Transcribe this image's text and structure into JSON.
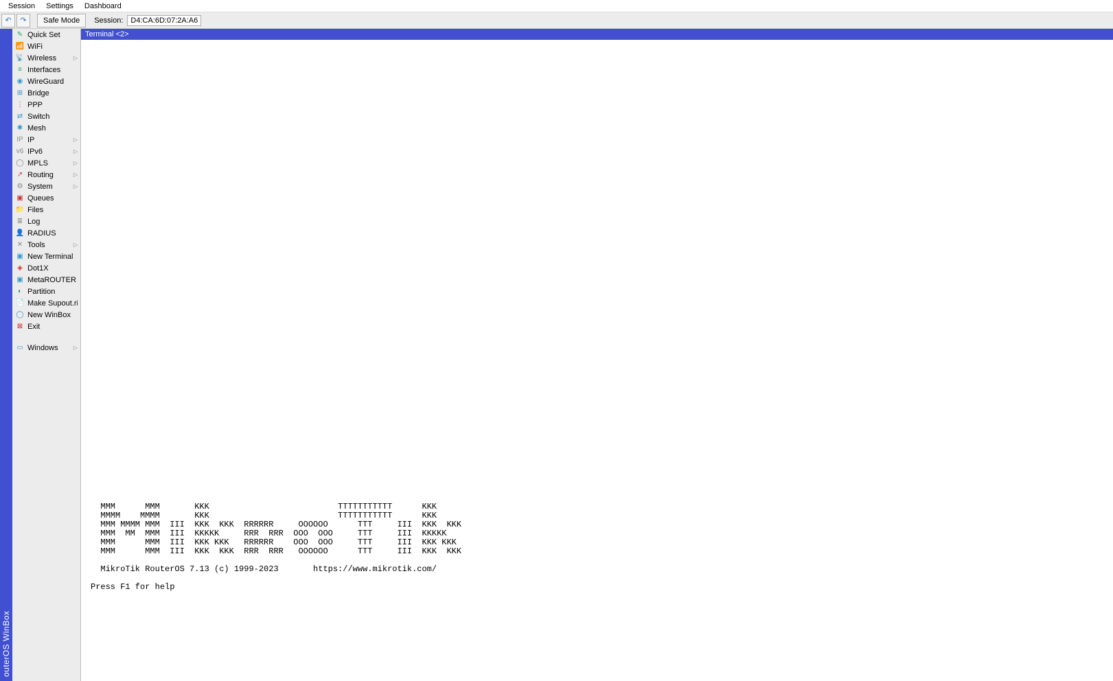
{
  "menubar": [
    "Session",
    "Settings",
    "Dashboard"
  ],
  "toolbar": {
    "undo_glyph": "↶",
    "redo_glyph": "↷",
    "safe_mode": "Safe Mode",
    "session_label": "Session:",
    "session_value": "D4:CA:6D:07:2A:A6"
  },
  "vbar_text": "outerOS WinBox",
  "sidebar": [
    {
      "icon": "✎",
      "color": "#2a6",
      "label": "Quick Set",
      "arrow": false
    },
    {
      "icon": "📶",
      "color": "#39c",
      "label": "WiFi",
      "arrow": false
    },
    {
      "icon": "📡",
      "color": "#39c",
      "label": "Wireless",
      "arrow": true
    },
    {
      "icon": "≡",
      "color": "#2a6",
      "label": "Interfaces",
      "arrow": false
    },
    {
      "icon": "◉",
      "color": "#39c",
      "label": "WireGuard",
      "arrow": false
    },
    {
      "icon": "⊞",
      "color": "#39c",
      "label": "Bridge",
      "arrow": false
    },
    {
      "icon": "⋮",
      "color": "#c33",
      "label": "PPP",
      "arrow": false
    },
    {
      "icon": "⇄",
      "color": "#39c",
      "label": "Switch",
      "arrow": false
    },
    {
      "icon": "✱",
      "color": "#39c",
      "label": "Mesh",
      "arrow": false
    },
    {
      "icon": "IP",
      "color": "#888",
      "label": "IP",
      "arrow": true
    },
    {
      "icon": "v6",
      "color": "#888",
      "label": "IPv6",
      "arrow": true
    },
    {
      "icon": "◯",
      "color": "#888",
      "label": "MPLS",
      "arrow": true
    },
    {
      "icon": "↗",
      "color": "#c33",
      "label": "Routing",
      "arrow": true
    },
    {
      "icon": "⚙",
      "color": "#888",
      "label": "System",
      "arrow": true
    },
    {
      "icon": "▣",
      "color": "#c33",
      "label": "Queues",
      "arrow": false
    },
    {
      "icon": "📁",
      "color": "#39c",
      "label": "Files",
      "arrow": false
    },
    {
      "icon": "≣",
      "color": "#888",
      "label": "Log",
      "arrow": false
    },
    {
      "icon": "👤",
      "color": "#fa0",
      "label": "RADIUS",
      "arrow": false
    },
    {
      "icon": "✕",
      "color": "#888",
      "label": "Tools",
      "arrow": true
    },
    {
      "icon": "▣",
      "color": "#39c",
      "label": "New Terminal",
      "arrow": false
    },
    {
      "icon": "◈",
      "color": "#c33",
      "label": "Dot1X",
      "arrow": false
    },
    {
      "icon": "▣",
      "color": "#39c",
      "label": "MetaROUTER",
      "arrow": false
    },
    {
      "icon": "◐",
      "color": "#2a6",
      "label": "Partition",
      "arrow": false
    },
    {
      "icon": "📄",
      "color": "#39c",
      "label": "Make Supout.rif",
      "arrow": false
    },
    {
      "icon": "◯",
      "color": "#39c",
      "label": "New WinBox",
      "arrow": false
    },
    {
      "icon": "⊠",
      "color": "#c33",
      "label": "Exit",
      "arrow": false
    }
  ],
  "sidebar_windows": {
    "icon": "▭",
    "color": "#39c",
    "label": "Windows",
    "arrow": true
  },
  "terminal": {
    "title": "Terminal <2>",
    "ascii": "  MMM      MMM       KKK                          TTTTTTTTTTT      KKK\n  MMMM    MMMM       KKK                          TTTTTTTTTTT      KKK\n  MMM MMMM MMM  III  KKK  KKK  RRRRRR     OOOOOO      TTT     III  KKK  KKK\n  MMM  MM  MMM  III  KKKKK     RRR  RRR  OOO  OOO     TTT     III  KKKKK\n  MMM      MMM  III  KKK KKK   RRRRRR    OOO  OOO     TTT     III  KKK KKK\n  MMM      MMM  III  KKK  KKK  RRR  RRR   OOOOOO      TTT     III  KKK  KKK\n\n  MikroTik RouterOS 7.13 (c) 1999-2023       https://www.mikrotik.com/\n\nPress F1 for help"
  }
}
